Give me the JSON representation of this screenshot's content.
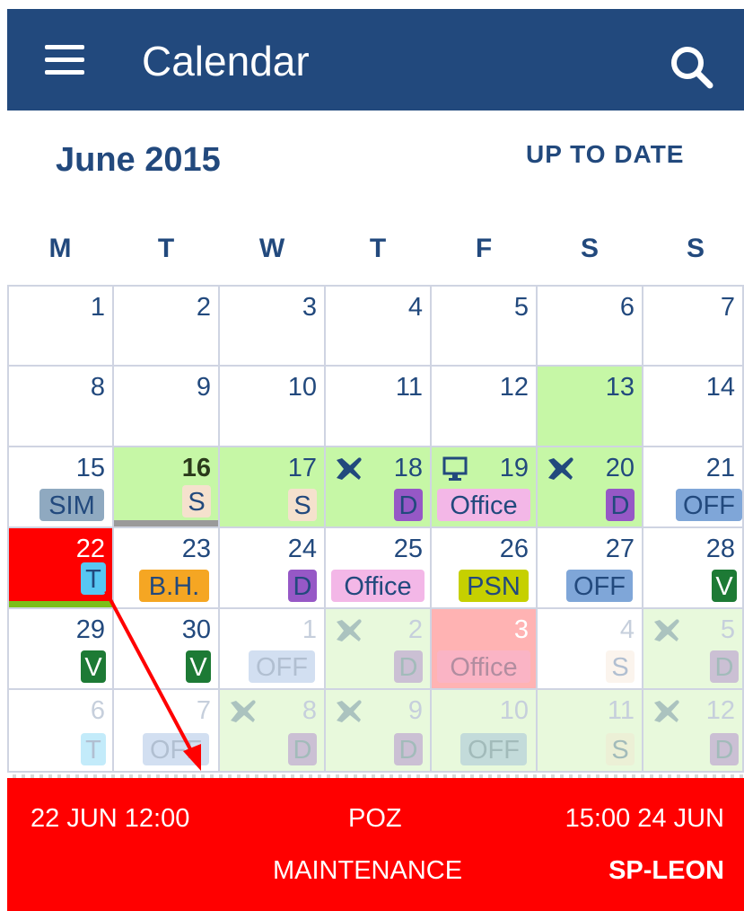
{
  "app": {
    "title": "Calendar"
  },
  "header": {
    "month": "June 2015",
    "up_to_date": "UP TO DATE"
  },
  "weekdays": [
    "M",
    "T",
    "W",
    "T",
    "F",
    "S",
    "S"
  ],
  "days": {
    "d1": "1",
    "d2": "2",
    "d3": "3",
    "d4": "4",
    "d5": "5",
    "d6": "6",
    "d7": "7",
    "d8": "8",
    "d9": "9",
    "d10": "10",
    "d11": "11",
    "d12": "12",
    "d13": "13",
    "d14": "14",
    "d15": "15",
    "d16": "16",
    "d17": "17",
    "d18": "18",
    "d19": "19",
    "d20": "20",
    "d21": "21",
    "d22": "22",
    "d23": "23",
    "d24": "24",
    "d25": "25",
    "d26": "26",
    "d27": "27",
    "d28": "28",
    "d29": "29",
    "d30": "30",
    "n1": "1",
    "n2": "2",
    "n3": "3",
    "n4": "4",
    "n5": "5",
    "n6": "6",
    "n7": "7",
    "n8": "8",
    "n9": "9",
    "n10": "10",
    "n11": "11",
    "n12": "12"
  },
  "badges": {
    "sim": "SIM",
    "s": "S",
    "d": "D",
    "office": "Office",
    "off": "OFF",
    "t": "T",
    "bh": "B.H.",
    "psn": "PSN",
    "v": "V"
  },
  "event": {
    "start": "22 JUN 12:00",
    "location": "POZ",
    "end": "15:00 24 JUN",
    "type": "MAINTENANCE",
    "aircraft": "SP-LEON"
  },
  "colors": {
    "primary": "#22497d",
    "event_red": "#ff0000",
    "green_day": "#c6f7a6",
    "duty_purple": "#9658c6"
  },
  "icons": [
    "menu-icon",
    "search-icon",
    "airplane-icon",
    "monitor-icon"
  ]
}
